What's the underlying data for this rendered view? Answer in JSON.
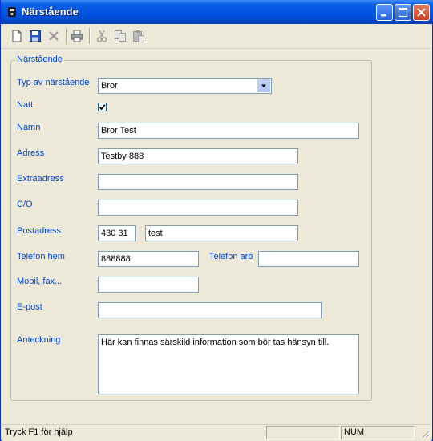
{
  "window": {
    "title": "Närstående"
  },
  "toolbar": {
    "icons": [
      "new-document-icon",
      "save-icon",
      "delete-icon",
      "print-icon",
      "cut-icon",
      "copy-icon",
      "paste-icon"
    ]
  },
  "form": {
    "group_label": "Närstående",
    "typ_label": "Typ av närstående",
    "typ_value": "Bror",
    "natt_label": "Natt",
    "natt_checked": true,
    "namn_label": "Namn",
    "namn_value": "Bror Test",
    "adress_label": "Adress",
    "adress_value": "Testby 888",
    "extraadress_label": "Extraadress",
    "extraadress_value": "",
    "co_label": "C/O",
    "co_value": "",
    "postadress_label": "Postadress",
    "postnummer_value": "430 31",
    "postort_value": "test",
    "telefon_hem_label": "Telefon hem",
    "telefon_hem_value": "888888",
    "telefon_arb_label": "Telefon arb",
    "telefon_arb_value": "",
    "mobil_label": "Mobil, fax...",
    "mobil_value": "",
    "epost_label": "E-post",
    "epost_value": "",
    "anteckning_label": "Anteckning",
    "anteckning_value": "Här kan finnas särskild information som bör tas hänsyn till."
  },
  "statusbar": {
    "help_text": "Tryck F1 för hjälp",
    "num_indicator": "NUM"
  },
  "colors": {
    "label_blue": "#0046d5",
    "titlebar_blue": "#0054e3",
    "window_bg": "#ece9d8"
  }
}
